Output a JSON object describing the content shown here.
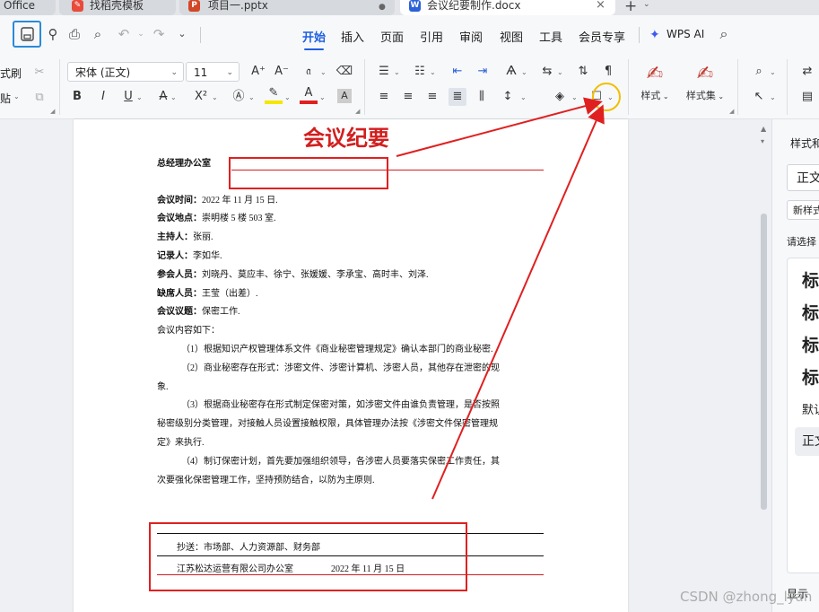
{
  "tabs": [
    {
      "label": "Office",
      "icon": "wps-office-icon",
      "active": false
    },
    {
      "label": "找稻壳模板",
      "icon": "docer-icon",
      "active": false
    },
    {
      "label": "项目一.pptx",
      "icon": "pptx-icon",
      "active": false
    },
    {
      "label": "会议纪要制作.docx",
      "icon": "docx-icon",
      "active": true
    }
  ],
  "new_tab_symbol": "+",
  "menu": [
    "开始",
    "插入",
    "页面",
    "引用",
    "审阅",
    "视图",
    "工具",
    "会员专享",
    "WPS AI"
  ],
  "ribbon": {
    "format_painter_label": "式刷",
    "paste_label": "贴",
    "font_name": "宋体 (正文)",
    "font_size": "11",
    "style_label": "样式",
    "style_set_label": "样式集"
  },
  "document": {
    "title": "会议纪要",
    "office": "总经理办公室",
    "fields": [
      {
        "key": "会议时间：",
        "value": "2022 年 11 月 15 日."
      },
      {
        "key": "会议地点：",
        "value": "崇明楼 5 楼 503 室."
      },
      {
        "key": "主持人：",
        "value": "张丽."
      },
      {
        "key": "记录人：",
        "value": "李如华."
      },
      {
        "key": "参会人员：",
        "value": "刘晓丹、莫应丰、徐宁、张媛媛、李承宝、高时丰、刘泽."
      },
      {
        "key": "缺席人员：",
        "value": "王莹（出差）."
      },
      {
        "key": "会议议题：",
        "value": "保密工作."
      }
    ],
    "intro": "会议内容如下：",
    "body_lines": [
      "（1）根据知识产权管理体系文件《商业秘密管理规定》确认本部门的商业秘密.",
      "（2）商业秘密存在形式：涉密文件、涉密计算机、涉密人员，其他存在泄密的现",
      "象.",
      "（3）根据商业秘密存在形式制定保密对策，如涉密文件由谁负责管理，是否按照",
      "秘密级别分类管理，对接触人员设置接触权限，具体管理办法按《涉密文件保密管理规",
      "定》来执行.",
      "（4）制订保密计划，首先要加强组织领导，各涉密人员要落实保密工作责任，其",
      "次要强化保密管理工作，坚持预防结合，以防为主原则."
    ],
    "cc_line": "抄送：市场部、人力资源部、财务部",
    "footer_org": "江苏松达运营有限公司办公室",
    "footer_date": "2022 年 11 月 15 日"
  },
  "right_panel": {
    "title": "样式和",
    "current_style": "正文",
    "new_style": "新样式",
    "select_label": "请选择",
    "styles": [
      "标",
      "标",
      "标",
      "标"
    ],
    "default_label": "默认",
    "body_style": "正文",
    "show_label": "显示"
  },
  "watermark": "CSDN @zhong_lyan",
  "colors": {
    "accent": "#1f5fe0",
    "annotation_red": "#e02020",
    "highlight_yellow": "#f0c000",
    "rule_red": "#d21f1f"
  }
}
